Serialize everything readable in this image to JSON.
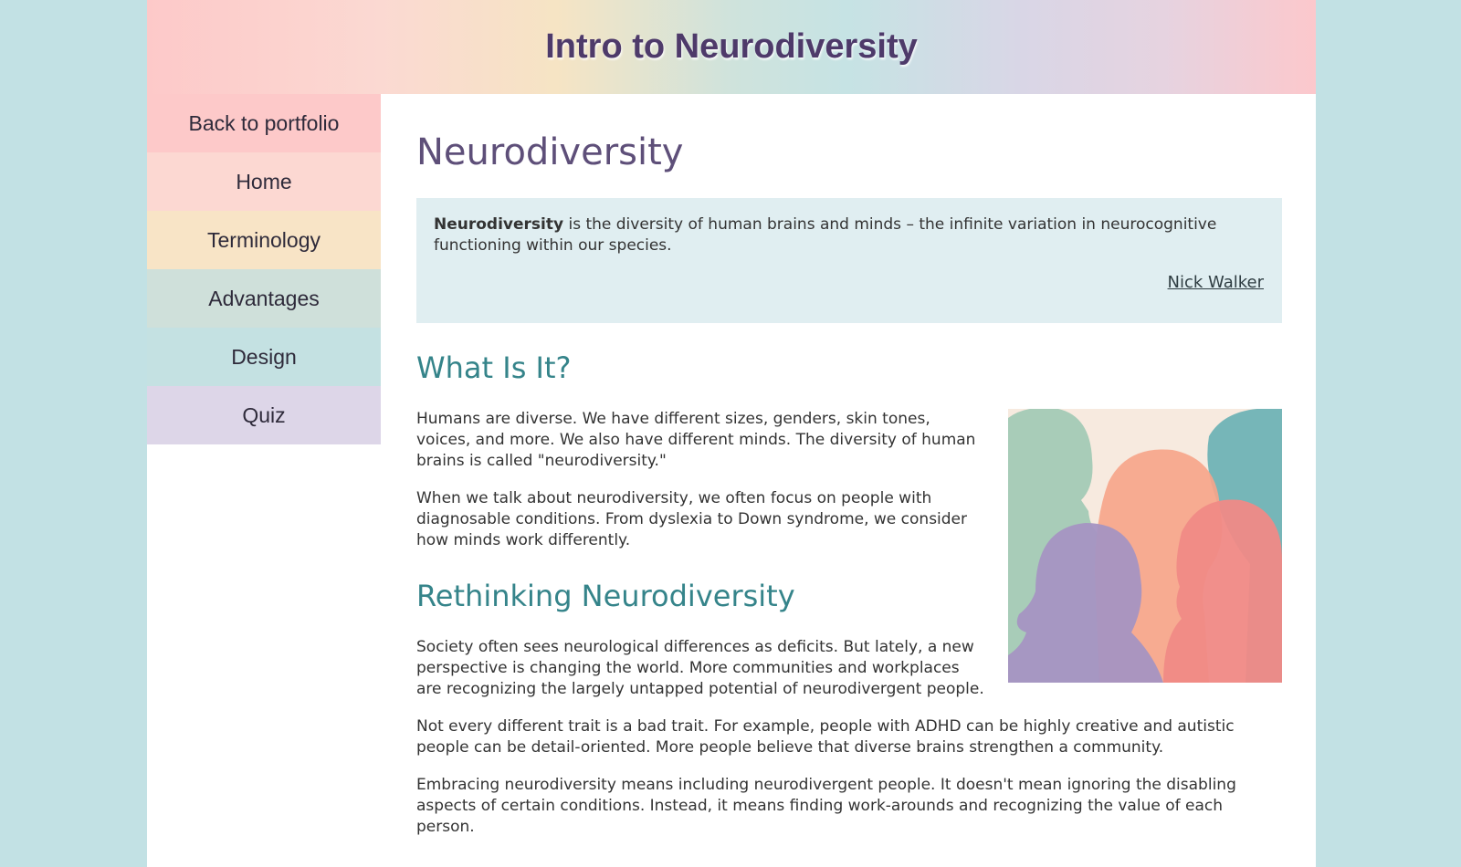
{
  "header": {
    "title": "Intro to Neurodiversity"
  },
  "nav": {
    "items": [
      {
        "label": "Back to portfolio",
        "color": "#fdc9c9"
      },
      {
        "label": "Home",
        "color": "#fcd8d2"
      },
      {
        "label": "Terminology",
        "color": "#f8e4c6"
      },
      {
        "label": "Advantages",
        "color": "#cfe0da"
      },
      {
        "label": "Design",
        "color": "#c4e1e2"
      },
      {
        "label": "Quiz",
        "color": "#ddd6e8"
      }
    ]
  },
  "main": {
    "title": "Neurodiversity",
    "quote": {
      "term": "Neurodiversity",
      "text": " is the diversity of human brains and minds – the infinite variation in neurocognitive functioning within our species.",
      "author": "Nick Walker"
    },
    "section1": {
      "heading": "What Is It?",
      "paragraphs": [
        "Humans are diverse. We have different sizes, genders, skin tones, voices, and more. We also have different minds. The diversity of human brains is called \"neurodiversity.\"",
        "When we talk about neurodiversity, we often focus on people with diagnosable conditions. From dyslexia to Down syndrome, we consider how minds work differently."
      ]
    },
    "section2": {
      "heading": "Rethinking Neurodiversity",
      "paragraphs": [
        "Society often sees neurological differences as deficits. But lately, a new perspective is changing the world. More communities and workplaces are recognizing the largely untapped potential of neurodivergent people.",
        "Not every different trait is a bad trait. For example, people with ADHD can be highly creative and autistic people can be detail-oriented. More people believe that diverse brains strengthen a community.",
        "Embracing neurodiversity means including neurodivergent people. It doesn't mean ignoring the disabling aspects of certain conditions. Instead, it means finding work-arounds and recognizing the value of each person."
      ]
    }
  }
}
